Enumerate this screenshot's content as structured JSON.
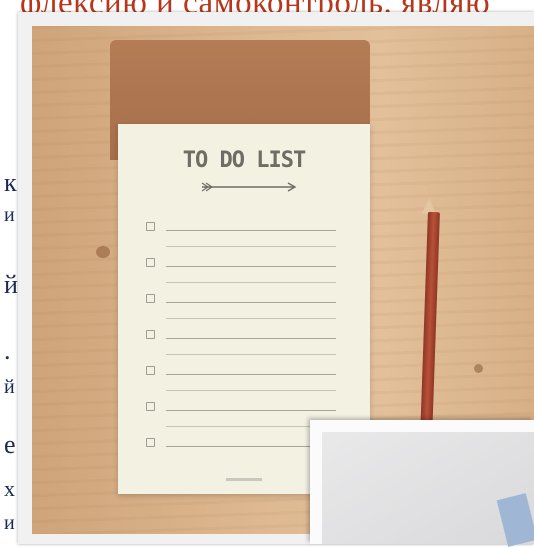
{
  "page": {
    "top_text": "флексию и самоконтроль. являю",
    "side_letters": [
      "к",
      "и",
      "й",
      ".",
      "й",
      "е",
      "х",
      "и"
    ]
  },
  "photo": {
    "pad_title": "TO DO LIST",
    "checklist_rows": 7,
    "colors": {
      "wood": "#dcb68c",
      "pad": "#f3f2e2",
      "cover": "#b07852",
      "pencil": "#a84430",
      "accent_text": "#b7361c"
    }
  }
}
